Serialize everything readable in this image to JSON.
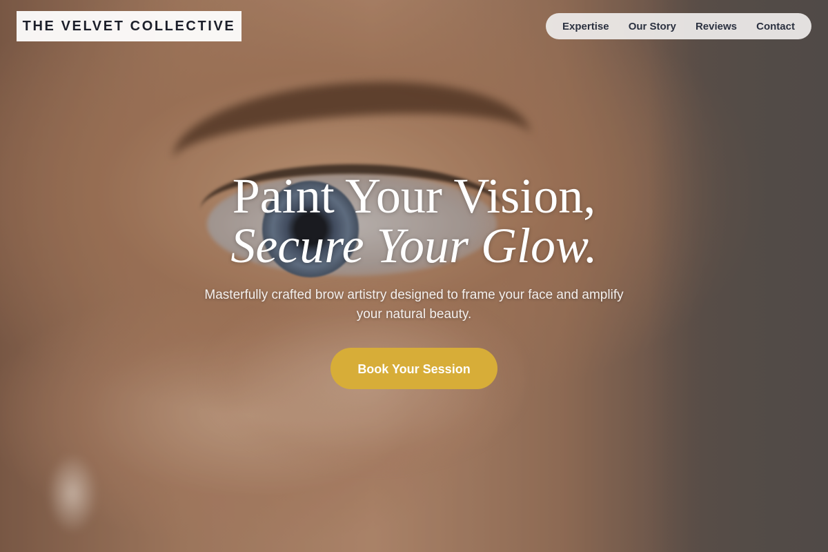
{
  "brand": {
    "name": "THE VELVET COLLECTIVE"
  },
  "nav": {
    "items": [
      {
        "label": "Expertise"
      },
      {
        "label": "Our Story"
      },
      {
        "label": "Reviews"
      },
      {
        "label": "Contact"
      }
    ]
  },
  "hero": {
    "headline_line1": "Paint Your Vision,",
    "headline_line2": "Secure Your Glow.",
    "subtext": "Masterfully crafted brow artistry designed to frame your face and amplify your natural beauty.",
    "cta_label": "Book Your Session",
    "image_alt": "Close-up of eye with groomed brow"
  },
  "colors": {
    "accent": "#d7ad38",
    "text_dark": "#1c1f2a",
    "nav_text": "#2b3140",
    "headline": "#ffffff"
  }
}
